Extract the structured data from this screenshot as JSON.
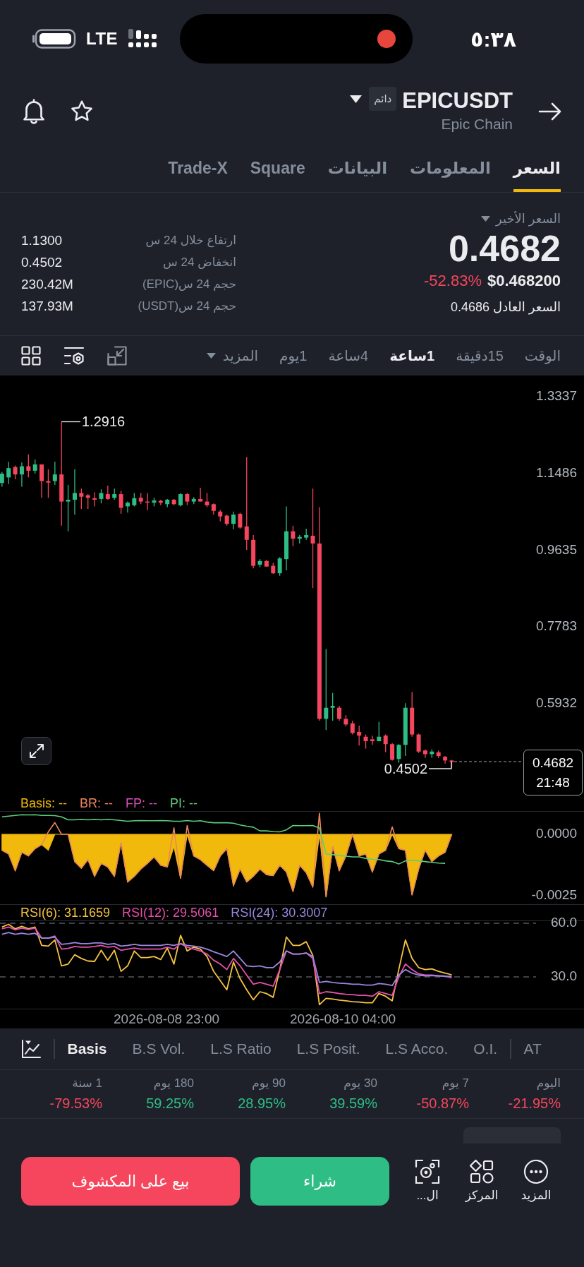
{
  "status_bar": {
    "time": "٥:٣٨",
    "network": "LTE"
  },
  "header": {
    "symbol": "EPICUSDT",
    "contract_badge": "دائم",
    "name": "Epic Chain"
  },
  "tabs": [
    {
      "label": "السعر",
      "selected": true
    },
    {
      "label": "المعلومات",
      "selected": false
    },
    {
      "label": "البيانات",
      "selected": false
    },
    {
      "label": "Square",
      "selected": false
    },
    {
      "label": "Trade-X",
      "selected": false
    }
  ],
  "price": {
    "label": "السعر الأخير",
    "last": "0.4682",
    "usd": "$0.468200",
    "change": {
      "text": "-52.83%",
      "color": "#f6465d"
    },
    "fair_price": "السعر العادل 0.4686"
  },
  "stats": [
    {
      "label": "ارتفاع خلال 24 س",
      "value": "1.1300"
    },
    {
      "label": "انخفاض 24 س",
      "value": "0.4502"
    },
    {
      "label": "حجم 24 س(EPIC)",
      "value": "230.42M"
    },
    {
      "label": "حجم 24 س(USDT)",
      "value": "137.93M"
    }
  ],
  "timeframes": [
    {
      "label": "الوقت",
      "selected": false
    },
    {
      "label": "15دقيقة",
      "selected": false
    },
    {
      "label": "1ساعة",
      "selected": true
    },
    {
      "label": "4ساعة",
      "selected": false
    },
    {
      "label": "1يوم",
      "selected": false
    }
  ],
  "more_menu": "المزيد",
  "candle_chart": {
    "price_axis": [
      "1.3337",
      "1.1486",
      "0.9635",
      "0.7783",
      "0.5932"
    ],
    "high_marker": "1.2916",
    "low_marker": "0.4502",
    "current_price": "0.4682",
    "countdown": "21:48"
  },
  "basis_panel": {
    "legend": [
      {
        "label": "PI: --",
        "color": "#5ccf7a"
      },
      {
        "label": "FP: --",
        "color": "#e04fc0"
      },
      {
        "label": "BR: --",
        "color": "#e8875a"
      },
      {
        "label": "Basis: --",
        "color": "#f0b90b"
      }
    ],
    "chart_data": {
      "type": "area",
      "series": [
        {
          "color": "#f0b90b",
          "values": [
            -0.00065,
            -0.0008,
            -0.00148,
            -0.00073,
            -0.00088,
            -0.00058,
            -0.00042,
            -0.00065,
            0,
            0,
            0,
            -0.00111,
            -0.00138,
            -0.00103,
            -0.00171,
            -0.00118,
            -0.00133,
            -0.00171,
            -0.00035,
            -0.00194,
            -0.00171,
            -0.00141,
            -0.00118,
            -0.00092,
            -0.00126,
            -0.00133,
            -0.0005,
            -0.00179,
            0,
            -0.00088,
            -0.00103,
            -0.00126,
            -0.00148,
            -0.00088,
            -0.00058,
            -0.00209,
            -0.00141,
            -0.00194,
            -0.00171,
            -0.00141,
            -0.00164,
            -0.00168,
            -0.00126,
            -0.00153,
            -0.00232,
            -0.00126,
            -0.00156,
            -0.00214,
            0,
            -0.00255,
            -0.0005,
            -0.00148,
            -0.00088,
            0,
            -0.00088,
            -0.0008,
            -0.00153,
            -0.0008,
            -0.00065,
            0,
            -0.00058,
            -0.00065,
            -0.00247,
            -0.00141,
            -0.00065,
            -0.00111,
            -0.00088,
            -0.00073,
            0
          ]
        },
        {
          "type": "line",
          "color": "#e8875a",
          "values": [
            -0.00065,
            -0.0008,
            -0.00148,
            -0.00073,
            -0.00088,
            -0.00058,
            -0.00042,
            0.0001,
            0.00048,
            0,
            0,
            -0.00111,
            -0.00138,
            -0.00103,
            -0.00171,
            -0.00118,
            -0.00133,
            -0.00171,
            -0.00035,
            -0.00194,
            -0.00171,
            -0.00141,
            -0.00118,
            -0.00092,
            -0.00126,
            -0.00133,
            0.00026,
            -0.00179,
            0.00036,
            -0.00088,
            -0.00103,
            -0.00126,
            -0.00148,
            -0.00088,
            -0.00058,
            -0.00209,
            -0.00141,
            -0.00194,
            -0.00171,
            -0.00141,
            -0.00164,
            -0.00168,
            -0.00126,
            -0.00153,
            -0.00232,
            -0.00126,
            -0.00156,
            -0.00214,
            0.00086,
            -0.00255,
            -0.0005,
            -0.00148,
            -0.00088,
            0,
            -0.00088,
            -0.0008,
            -0.00153,
            -0.0008,
            -0.00065,
            0.0003,
            -0.00058,
            -0.00065,
            -0.00247,
            -0.00141,
            -0.00065,
            -0.00111,
            -0.00088,
            -0.00073,
            0
          ]
        },
        {
          "type": "line",
          "color": "#5ccf7a",
          "values": [
            0.00071,
            0.00074,
            0.00077,
            0.0008,
            0.00079,
            0.0008,
            0.00077,
            0.00077,
            0.00076,
            0.00071,
            0.00059,
            0.00059,
            0.00061,
            0.00059,
            0.00061,
            0.00059,
            0.00061,
            0.00059,
            0.00056,
            0.00053,
            0.00055,
            0.00056,
            0.00055,
            0.00055,
            0.00056,
            0.00055,
            0.00053,
            0.00053,
            0.00056,
            0.00053,
            0.00055,
            0.0005,
            0.00047,
            0.00047,
            0.00047,
            0.00045,
            0.00038,
            0.00033,
            0.00029,
            0.00014,
            0.00014,
            0.00011,
            0.0001,
            0.00018,
            0.00036,
            0.00035,
            0.00035,
            0.00036,
            0.00026,
            -0.0008,
            -0.00083,
            -0.00086,
            -0.00089,
            -0.00092,
            -0.00092,
            -0.00098,
            -0.00102,
            -0.00103,
            -0.00108,
            -0.00111,
            -0.00121,
            -0.00108,
            -0.00105,
            -0.00108,
            -0.00111,
            -0.00114,
            -0.00117,
            -0.00118,
            null
          ]
        }
      ],
      "ylim": [
        -0.002874,
        0.000948
      ],
      "yticks": [
        {
          "value": 0,
          "label": "0.0000"
        },
        {
          "value": -0.0025,
          "label": "-0.0025"
        }
      ]
    }
  },
  "rsi_panel": {
    "legend": [
      {
        "label": "RSI(24): 30.3007",
        "color": "#9a86df"
      },
      {
        "label": "RSI(12): 29.5061",
        "color": "#e44fae"
      },
      {
        "label": "RSI(6): 31.1659",
        "color": "#f5c342"
      }
    ],
    "chart_data": {
      "type": "line",
      "series": [
        {
          "color": "#f5c342",
          "values": [
            57.9,
            59.4,
            56.9,
            58.3,
            56.9,
            57.9,
            47.6,
            47.2,
            50.7,
            36.2,
            37.2,
            42.4,
            40.3,
            38.9,
            38.7,
            44.9,
            39.3,
            44.9,
            33.1,
            36.2,
            44.5,
            40.8,
            40.8,
            41.4,
            39.7,
            46.1,
            37.2,
            53.2,
            44.5,
            46.6,
            45.5,
            41.4,
            33.1,
            27.9,
            22.8,
            38.3,
            29.0,
            22.8,
            17.2,
            21.7,
            20.7,
            18.6,
            34.1,
            52.3,
            47.6,
            47.6,
            49.7,
            42.0,
            14.5,
            18.0,
            17.6,
            17.0,
            16.6,
            16.1,
            15.9,
            15.5,
            15.5,
            20.7,
            19.2,
            16.6,
            34.1,
            50.7,
            40.3,
            35.2,
            34.1,
            34.5,
            33.1,
            32.1,
            31.2
          ]
        },
        {
          "color": "#e44fae",
          "values": [
            56.9,
            57.9,
            56.3,
            57.3,
            56.5,
            57.3,
            51.7,
            51.7,
            52.8,
            45.5,
            45.9,
            47.0,
            46.6,
            46.6,
            47.0,
            47.6,
            46.6,
            47.0,
            44.9,
            45.5,
            46.1,
            45.5,
            45.5,
            45.5,
            45.5,
            46.6,
            45.5,
            48.6,
            46.6,
            45.5,
            44.5,
            42.8,
            39.3,
            37.2,
            34.1,
            40.3,
            36.2,
            31.0,
            25.9,
            26.9,
            25.9,
            24.8,
            34.1,
            44.5,
            42.8,
            42.8,
            43.4,
            40.3,
            20.7,
            21.7,
            21.3,
            20.7,
            20.3,
            20.1,
            19.7,
            19.7,
            19.2,
            21.7,
            20.7,
            19.7,
            30.0,
            37.2,
            34.1,
            31.7,
            31.0,
            31.0,
            30.6,
            30.4,
            29.5
          ]
        },
        {
          "color": "#9a86df",
          "values": [
            53.8,
            54.8,
            53.8,
            54.4,
            53.8,
            54.4,
            51.7,
            51.7,
            52.3,
            48.2,
            48.6,
            49.2,
            48.6,
            48.6,
            49.0,
            49.0,
            48.2,
            48.6,
            47.2,
            47.6,
            48.2,
            47.6,
            47.6,
            47.6,
            47.6,
            48.2,
            47.6,
            48.6,
            47.6,
            47.2,
            46.6,
            45.5,
            44.1,
            42.8,
            41.4,
            44.5,
            40.3,
            36.2,
            35.8,
            36.2,
            35.2,
            35.2,
            38.3,
            44.5,
            42.8,
            42.8,
            43.4,
            41.4,
            26.9,
            27.5,
            26.9,
            26.5,
            26.3,
            25.9,
            25.9,
            25.4,
            25.4,
            26.3,
            25.9,
            25.2,
            31.0,
            34.1,
            32.1,
            31.0,
            30.6,
            30.8,
            30.6,
            30.4,
            30.3
          ]
        }
      ],
      "ylim": [
        11.84,
        61.58
      ],
      "yticks": [
        {
          "value": 60,
          "label": "60.0"
        },
        {
          "value": 30,
          "label": "30.0"
        }
      ]
    },
    "date_labels": [
      "2026-08-10 04:00",
      "2026-08-08 23:00"
    ]
  },
  "indicator_tabs": [
    {
      "label": "AT",
      "selected": false
    },
    {
      "label": "O.I.",
      "selected": false
    },
    {
      "label": "L.S Acco.",
      "selected": false
    },
    {
      "label": "L.S Posit.",
      "selected": false
    },
    {
      "label": "L.S Ratio",
      "selected": false
    },
    {
      "label": "B.S Vol.",
      "selected": false
    },
    {
      "label": "Basis",
      "selected": true
    }
  ],
  "performance": [
    {
      "period": "اليوم",
      "change": "-21.95%",
      "color": "#f6465d"
    },
    {
      "period": "7 يوم",
      "change": "-50.87%",
      "color": "#f6465d"
    },
    {
      "period": "30 يوم",
      "change": "39.59%",
      "color": "#2ebd85"
    },
    {
      "period": "90 يوم",
      "change": "28.95%",
      "color": "#2ebd85"
    },
    {
      "period": "180 يوم",
      "change": "59.25%",
      "color": "#2ebd85"
    },
    {
      "period": "1 سنة",
      "change": "-79.53%",
      "color": "#f6465d"
    }
  ],
  "bottom_nav": [
    {
      "label": "المزيد"
    },
    {
      "label": "المركز"
    },
    {
      "label": "ال..."
    }
  ],
  "actions": {
    "buy": "شراء",
    "sell": "بيع على المكشوف"
  }
}
